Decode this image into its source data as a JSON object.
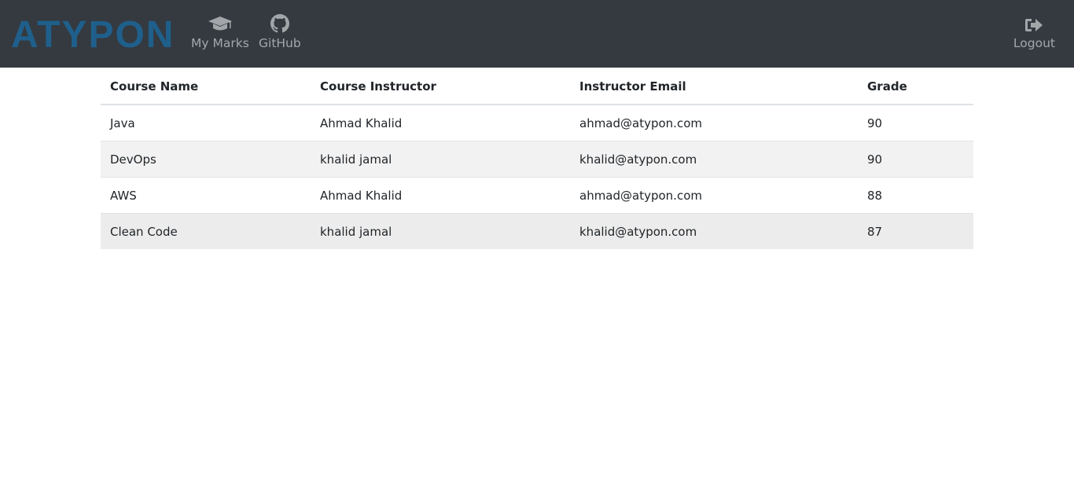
{
  "brand": {
    "logo_text": "ATYPON",
    "logo_color": "#1f5f8b"
  },
  "nav": {
    "marks": {
      "label": "My Marks",
      "icon": "graduation-cap-icon"
    },
    "github": {
      "label": "GitHub",
      "icon": "github-icon"
    },
    "logout": {
      "label": "Logout",
      "icon": "sign-out-icon"
    }
  },
  "colors": {
    "navbar_bg": "#343a40",
    "stripe": "#f2f2f2"
  },
  "table": {
    "headers": [
      "Course Name",
      "Course Instructor",
      "Instructor Email",
      "Grade"
    ],
    "rows": [
      {
        "course": "Java",
        "instructor": "Ahmad Khalid",
        "email": "ahmad@atypon.com",
        "grade": "90"
      },
      {
        "course": "DevOps",
        "instructor": "khalid jamal",
        "email": "khalid@atypon.com",
        "grade": "90"
      },
      {
        "course": "AWS",
        "instructor": "Ahmad Khalid",
        "email": "ahmad@atypon.com",
        "grade": "88"
      },
      {
        "course": "Clean Code",
        "instructor": "khalid jamal",
        "email": "khalid@atypon.com",
        "grade": "87"
      }
    ]
  }
}
